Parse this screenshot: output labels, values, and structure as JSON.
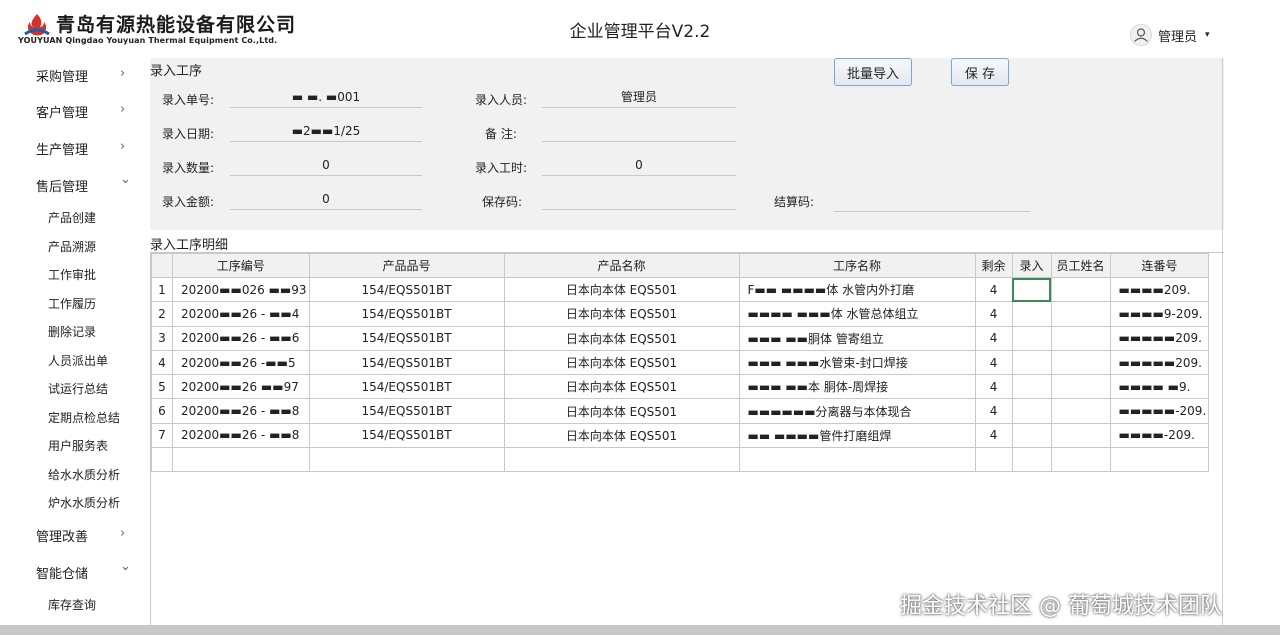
{
  "header": {
    "company_cn": "青岛有源热能设备有限公司",
    "company_en": "YOUYUAN Qingdao Youyuan Thermal Equipment Co.,Ltd.",
    "app_title": "企业管理平台V2.2",
    "user_name": "管理员",
    "user_caret": "▾"
  },
  "sidebar": {
    "groups": [
      {
        "label": "采购管理",
        "arrow": "›"
      },
      {
        "label": "客户管理",
        "arrow": "›"
      },
      {
        "label": "生产管理",
        "arrow": "›"
      },
      {
        "label": "售后管理",
        "arrow": "⌄"
      },
      {
        "label": "管理改善",
        "arrow": "›"
      },
      {
        "label": "智能仓储",
        "arrow": "⌄"
      }
    ],
    "after_sales_items": [
      "产品创建",
      "产品溯源",
      "工作审批",
      "工作履历",
      "删除记录",
      "人员派出单",
      "试运行总结",
      "定期点检总结",
      "用户服务表",
      "给水水质分析",
      "炉水水质分析"
    ],
    "warehouse_items": [
      "库存查询"
    ]
  },
  "form": {
    "section_title": "录入工序",
    "buttons": {
      "batch_import": "批量导入",
      "save": "保 存"
    },
    "fields": {
      "order_no_label": "录入单号:",
      "order_no_value": "▬ ▬. ▬001",
      "person_label": "录入人员:",
      "person_value": "管理员",
      "date_label": "录入日期:",
      "date_value": "▬2▬▬1/25",
      "remark_label": "备  注:",
      "remark_value": "",
      "qty_label": "录入数量:",
      "qty_value": "0",
      "hours_label": "录入工时:",
      "hours_value": "0",
      "amount_label": "录入金额:",
      "amount_value": "0",
      "keep_code_label": "保存码:",
      "keep_code_value": "",
      "settle_code_label": "结算码:",
      "settle_code_value": ""
    }
  },
  "detail": {
    "title": "录入工序明细",
    "columns": [
      "",
      "工序编号",
      "产品品号",
      "产品名称",
      "工序名称",
      "剩余",
      "录入",
      "员工姓名",
      "连番号"
    ],
    "rows": [
      [
        "1",
        "20200▬▬026 ▬▬93",
        "154/EQS501BT",
        "日本向本体 EQS501",
        "F▬▬ ▬▬▬▬体 水管内外打磨",
        "4",
        "",
        "",
        "▬▬▬▬209."
      ],
      [
        "2",
        "20200▬▬26 - ▬▬4",
        "154/EQS501BT",
        "日本向本体 EQS501",
        "▬▬▬▬ ▬▬▬体 水管总体组立",
        "4",
        "",
        "",
        "▬▬▬▬9-209."
      ],
      [
        "3",
        "20200▬▬26 - ▬▬6",
        "154/EQS501BT",
        "日本向本体 EQS501",
        "▬▬▬ ▬▬胴体 管寄组立",
        "4",
        "",
        "",
        "▬▬▬▬▬209."
      ],
      [
        "4",
        "20200▬▬26 -▬▬5",
        "154/EQS501BT",
        "日本向本体 EQS501",
        "▬▬▬ ▬▬▬水管束-封口焊接",
        "4",
        "",
        "",
        "▬▬▬▬▬209."
      ],
      [
        "5",
        "20200▬▬26  ▬▬97",
        "154/EQS501BT",
        "日本向本体 EQS501",
        "▬▬▬ ▬▬本 胴体-周焊接",
        "4",
        "",
        "",
        "▬▬▬▬ ▬9."
      ],
      [
        "6",
        "20200▬▬26 - ▬▬8",
        "154/EQS501BT",
        "日本向本体 EQS501",
        "▬▬▬▬▬▬分离器与本体现合",
        "4",
        "",
        "",
        "▬▬▬▬▬-209."
      ],
      [
        "7",
        "20200▬▬26 - ▬▬8",
        "154/EQS501BT",
        "日本向本体 EQS501",
        "▬▬ ▬▬▬▬管件打磨组焊",
        "4",
        "",
        "",
        "▬▬▬▬-209."
      ]
    ]
  },
  "watermark": "掘金技术社区 @ 葡萄城技术团队"
}
